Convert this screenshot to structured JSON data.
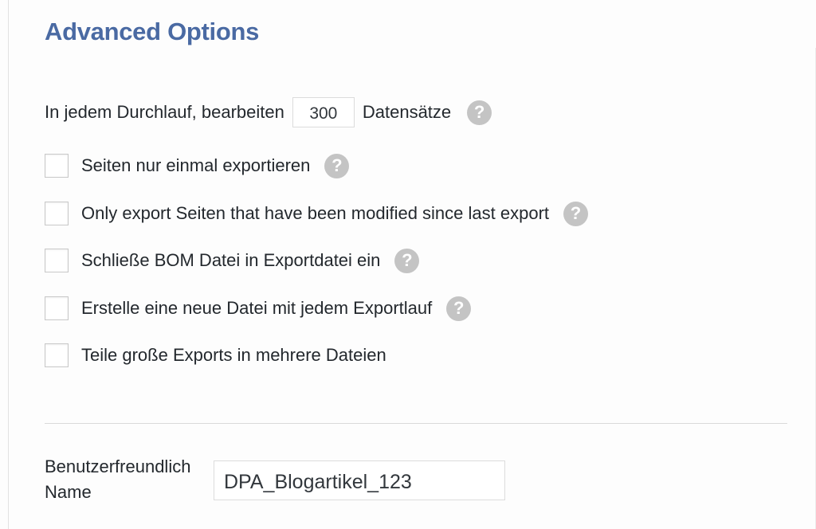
{
  "section": {
    "title": "Advanced Options"
  },
  "batch": {
    "label_before": "In jedem Durchlauf, bearbeiten",
    "value": "300",
    "label_after": "Datensätze",
    "help_icon": "question-circle-icon"
  },
  "options": [
    {
      "label": "Seiten nur einmal exportieren",
      "checked": false,
      "has_help": true
    },
    {
      "label": "Only export Seiten that have been modified since last export",
      "checked": false,
      "has_help": true
    },
    {
      "label": "Schließe BOM Datei in Exportdatei ein",
      "checked": false,
      "has_help": true
    },
    {
      "label": "Erstelle eine neue Datei mit jedem Exportlauf",
      "checked": false,
      "has_help": true
    },
    {
      "label": "Teile große Exports in mehrere Dateien",
      "checked": false,
      "has_help": false
    }
  ],
  "friendly_name": {
    "label": "Benutzerfreundlich Name",
    "value": "DPA_Blogartikel_123"
  },
  "colors": {
    "title": "#4a6aa3",
    "help_icon": "#c4c4c4",
    "text": "#23282d"
  }
}
